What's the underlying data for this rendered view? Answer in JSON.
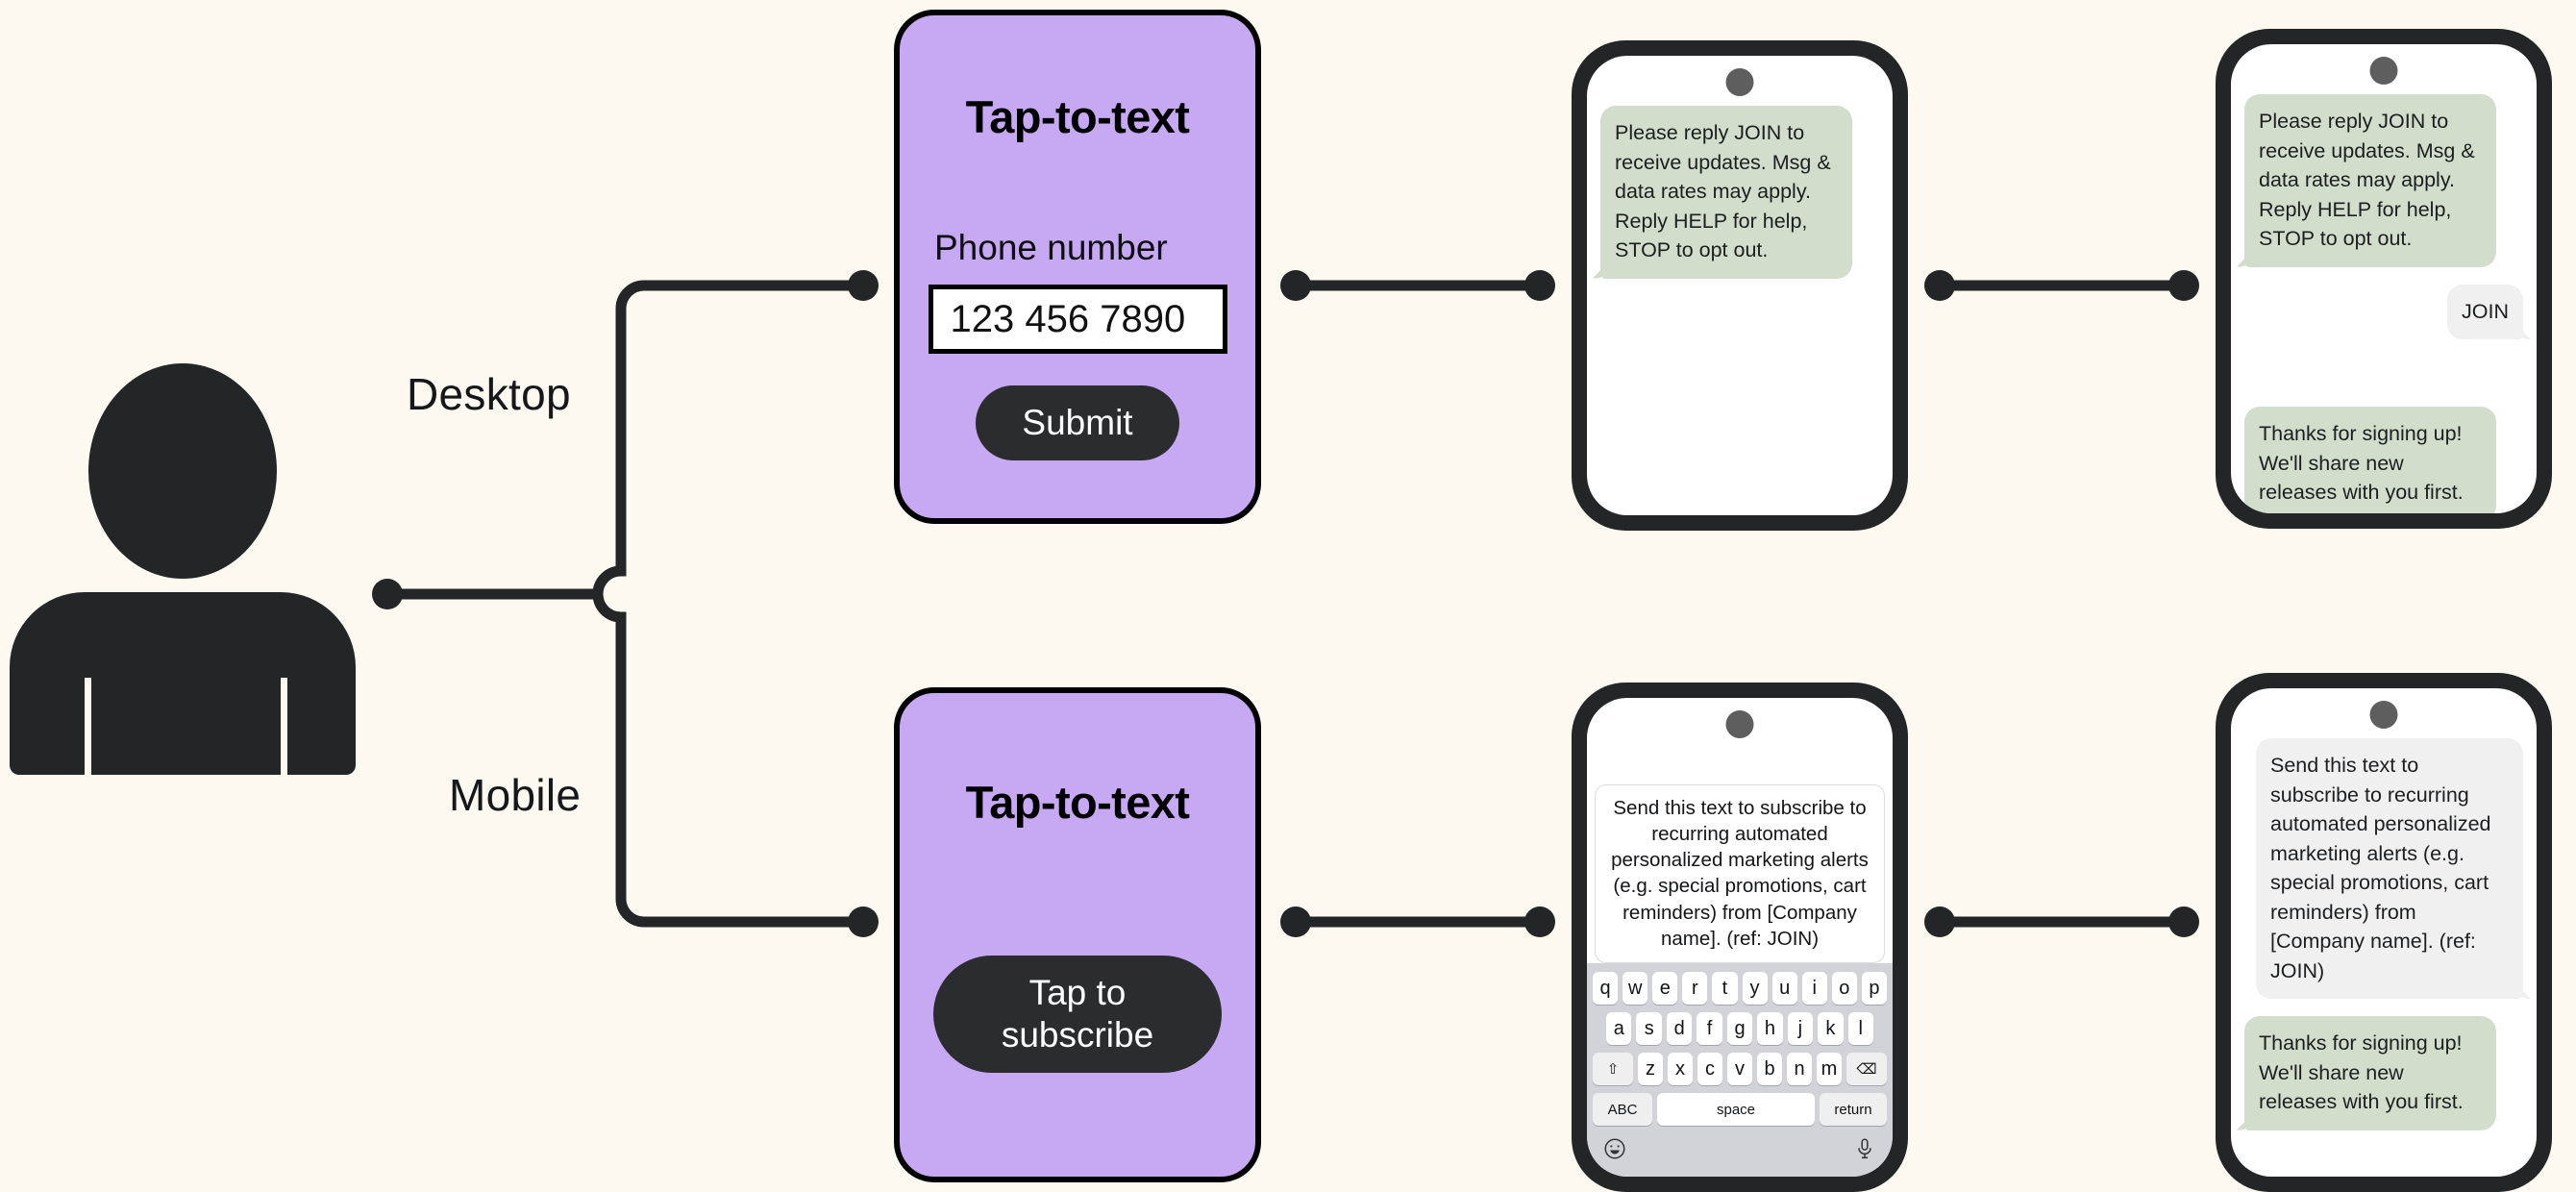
{
  "colors": {
    "background": "#FDF8F0",
    "card_purple": "#C7A8F2",
    "ink": "#232527",
    "bubble_incoming": "#D3DDCB",
    "bubble_outgoing": "#F0F0F0",
    "keyboard_bg": "#D1D3D9",
    "camera_dot": "#5E5E5E"
  },
  "flow": {
    "branches": [
      {
        "label": "Desktop"
      },
      {
        "label": "Mobile"
      }
    ]
  },
  "actor": {
    "name": "person-icon"
  },
  "desktop_card": {
    "title": "Tap-to-text",
    "field_label": "Phone number",
    "phone_value": "123 456 7890",
    "submit_label": "Submit"
  },
  "mobile_card": {
    "title": "Tap-to-text",
    "tap_label": "Tap to subscribe"
  },
  "messages": {
    "optin_prompt": "Please reply JOIN to receive updates. Msg & data rates may apply. Reply HELP for help, STOP to opt out.",
    "join_reply": "JOIN",
    "thanks": "Thanks for signing up! We'll share new releases with you first.",
    "prefilled_sms": "Send this text to subscribe to recurring automated personalized marketing alerts (e.g. special promotions, cart reminders) from [Company name]. (ref: JOIN)"
  },
  "keyboard": {
    "row1": [
      "q",
      "w",
      "e",
      "r",
      "t",
      "y",
      "u",
      "i",
      "o",
      "p"
    ],
    "row2": [
      "a",
      "s",
      "d",
      "f",
      "g",
      "h",
      "j",
      "k",
      "l"
    ],
    "row3": [
      "z",
      "x",
      "c",
      "v",
      "b",
      "n",
      "m"
    ],
    "shift_label": "⇧",
    "backspace_label": "⌫",
    "abc_label": "ABC",
    "space_label": "space",
    "return_label": "return",
    "emoji_icon": "emoji-icon",
    "mic_icon": "microphone-icon"
  }
}
